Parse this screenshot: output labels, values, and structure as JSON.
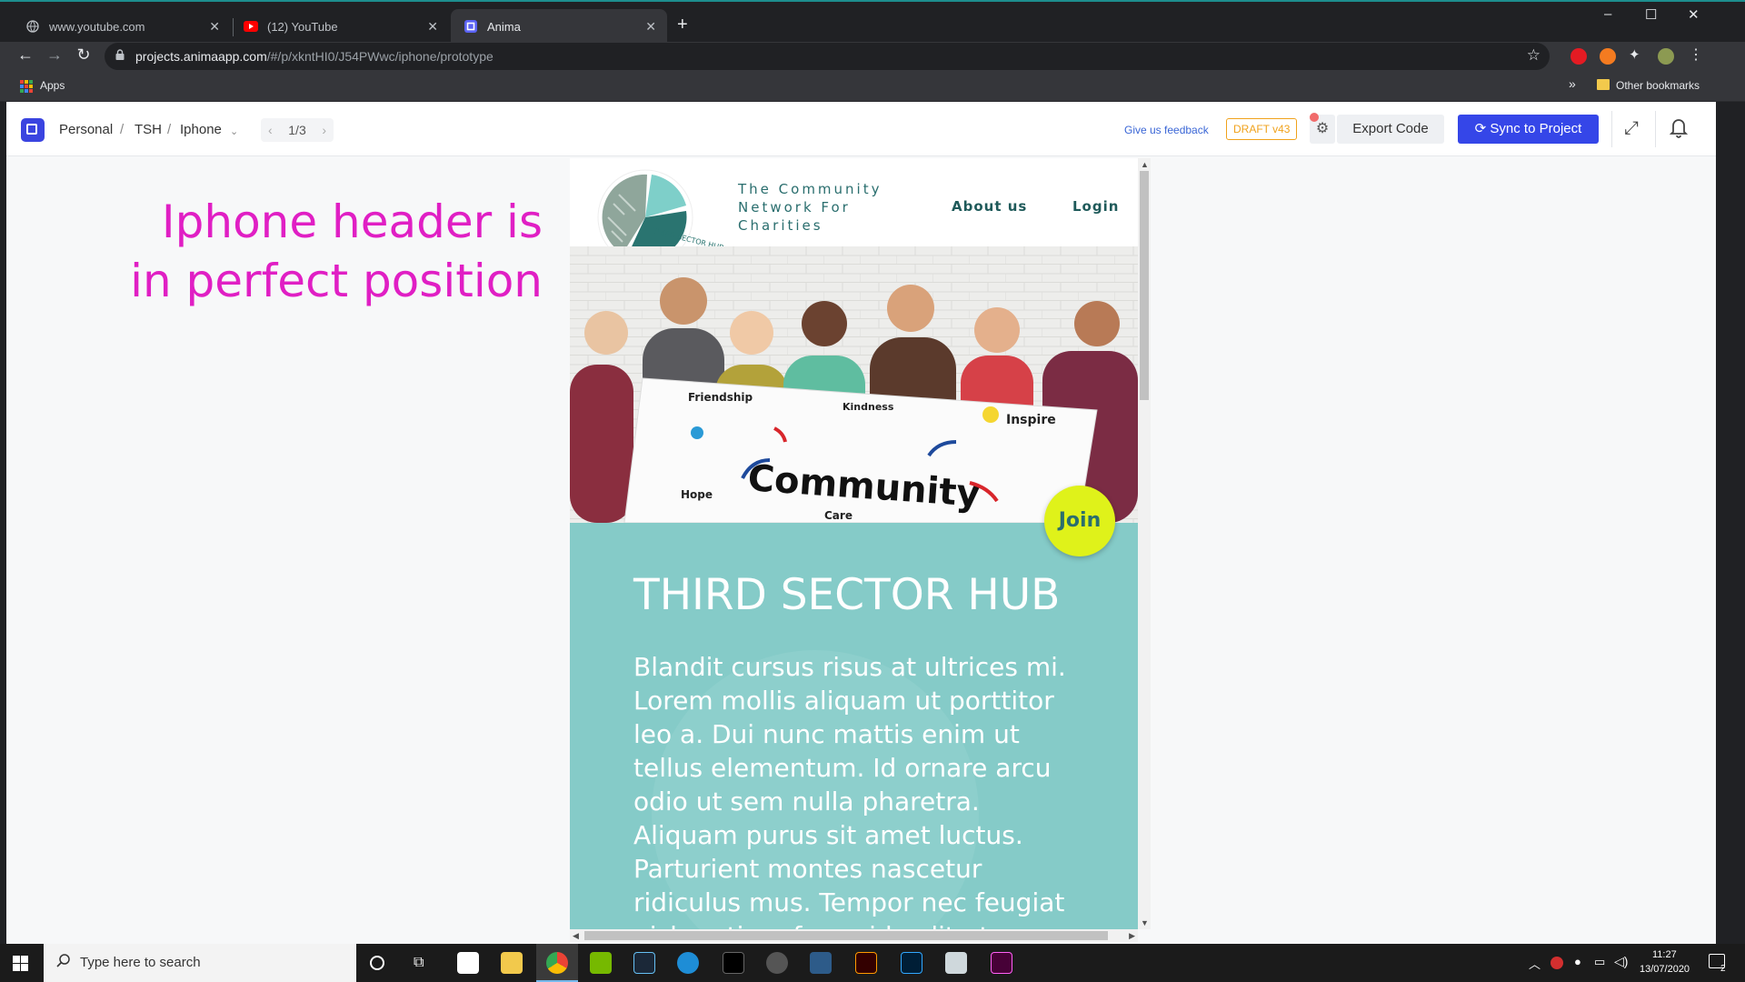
{
  "browser": {
    "tabs": [
      {
        "title": "www.youtube.com",
        "active": false
      },
      {
        "title": "(12) YouTube",
        "active": false
      },
      {
        "title": "Anima",
        "active": true
      }
    ],
    "new_tab_label": "+",
    "url_host": "projects.animaapp.com",
    "url_path": "/#/p/xkntHI0/J54PWwc/iphone/prototype",
    "bookmarks": {
      "apps_label": "Apps",
      "more_label": "»",
      "other_label": "Other bookmarks"
    },
    "window_controls": {
      "minimize": "–",
      "maximize": "☐",
      "close": "✕"
    }
  },
  "anima": {
    "breadcrumb": [
      "Personal",
      "TSH",
      "Iphone"
    ],
    "breadcrumb_sep": "/",
    "page_indicator": "1/3",
    "feedback_label": "Give us feedback",
    "draft_label": "DRAFT v43",
    "export_label": "Export Code",
    "sync_label": "Sync to Project"
  },
  "annotation": {
    "line1": "Iphone header is",
    "line2": "in perfect position"
  },
  "site": {
    "tagline": [
      "The Community",
      "Network For",
      "Charities"
    ],
    "logo_text": "THIRD SECTOR HUB",
    "nav": [
      "About us",
      "Login"
    ],
    "hero_banner": {
      "headline": "Community",
      "words": [
        "Friendship",
        "Kindness",
        "Inspire",
        "Hope",
        "Care"
      ]
    },
    "join_label": "Join",
    "section_title": "THIRD SECTOR HUB",
    "section_body": "Blandit cursus risus at ultrices mi. Lorem mollis aliquam ut porttitor leo a. Dui nunc mattis enim ut tellus elementum. Id ornare arcu odio ut sem nulla pharetra. Aliquam purus sit amet luctus. Parturient montes nascetur ridiculus mus. Tempor nec feugiat nisl pretium fusce id velit ut"
  },
  "taskbar": {
    "search_placeholder": "Type here to search",
    "time": "11:27",
    "date": "13/07/2020",
    "notifications": "2"
  },
  "colors": {
    "accent_teal": "#85cbc8",
    "anima_blue": "#3546e8",
    "annotation_magenta": "#e01fc4",
    "join_yellow": "#dff21a"
  }
}
